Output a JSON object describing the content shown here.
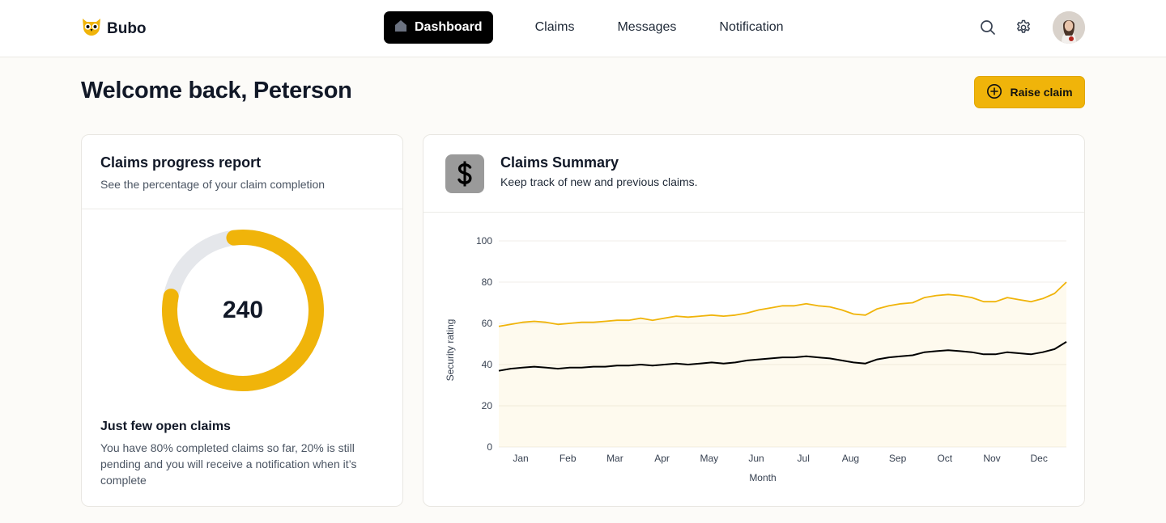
{
  "brand": {
    "name": "Bubo"
  },
  "nav": {
    "dashboard": "Dashboard",
    "claims": "Claims",
    "messages": "Messages",
    "notification": "Notification"
  },
  "header_icons": [
    "search-icon",
    "gear-icon"
  ],
  "welcome": "Welcome back, Peterson",
  "raise_claim": "Raise claim",
  "colors": {
    "accent": "#f0b40a",
    "dark": "#000000",
    "ring_track": "#e5e7eb"
  },
  "progress_card": {
    "title": "Claims progress report",
    "subtitle": "See the percentage of your claim completion",
    "value": "240",
    "completed_fraction": 0.8,
    "heading": "Just few open claims",
    "text": "You have 80% completed claims so far, 20% is still pending and you will receive a notification when it’s complete"
  },
  "summary_card": {
    "title": "Claims Summary",
    "subtitle": "Keep track of new and previous claims.",
    "icon": "dollar-icon"
  },
  "chart_data": {
    "type": "area",
    "xlabel": "Month",
    "ylabel": "Security rating",
    "ylim": [
      0,
      100
    ],
    "yticks": [
      0,
      20,
      40,
      60,
      80,
      100
    ],
    "grid": true,
    "categories": [
      "Jan",
      "Feb",
      "Mar",
      "Apr",
      "May",
      "Jun",
      "Jul",
      "Aug",
      "Sep",
      "Oct",
      "Nov",
      "Dec"
    ],
    "x": [
      0,
      0.5,
      1,
      1.5,
      2,
      2.5,
      3,
      3.5,
      4,
      4.5,
      5,
      5.5,
      6,
      6.5,
      7,
      7.5,
      8,
      8.5,
      9,
      9.5,
      10,
      10.5,
      11,
      11.5,
      12,
      12.5,
      13,
      13.5,
      14,
      14.5,
      15,
      15.5,
      16,
      16.5,
      17,
      17.5,
      18,
      18.5,
      19,
      19.5,
      20,
      20.5,
      21,
      21.5,
      22,
      22.5,
      23,
      23.5,
      24
    ],
    "series": [
      {
        "color": "#f0b40a",
        "values": [
          58.5,
          59.5,
          60.5,
          61,
          60.5,
          59.5,
          60,
          60.5,
          60.5,
          61,
          61.5,
          61.5,
          62.5,
          61.5,
          62.5,
          63.5,
          63,
          63.5,
          64,
          63.5,
          64,
          65,
          66.5,
          67.5,
          68.5,
          68.5,
          69.5,
          68.5,
          68,
          66.5,
          64.5,
          64,
          67,
          68.5,
          69.5,
          70,
          72.5,
          73.5,
          74,
          73.5,
          72.5,
          70.5,
          70.5,
          72.5,
          71.5,
          70.5,
          72,
          74.5,
          80
        ]
      },
      {
        "color": "#000000",
        "values": [
          37,
          38,
          38.5,
          39,
          38.5,
          38,
          38.5,
          38.5,
          39,
          39,
          39.5,
          39.5,
          40,
          39.5,
          40,
          40.5,
          40,
          40.5,
          41,
          40.5,
          41,
          42,
          42.5,
          43,
          43.5,
          43.5,
          44,
          43.5,
          43,
          42,
          41,
          40.5,
          42.5,
          43.5,
          44,
          44.5,
          46,
          46.5,
          47,
          46.5,
          46,
          45,
          45,
          46,
          45.5,
          45,
          46,
          47.5,
          51
        ]
      }
    ]
  }
}
